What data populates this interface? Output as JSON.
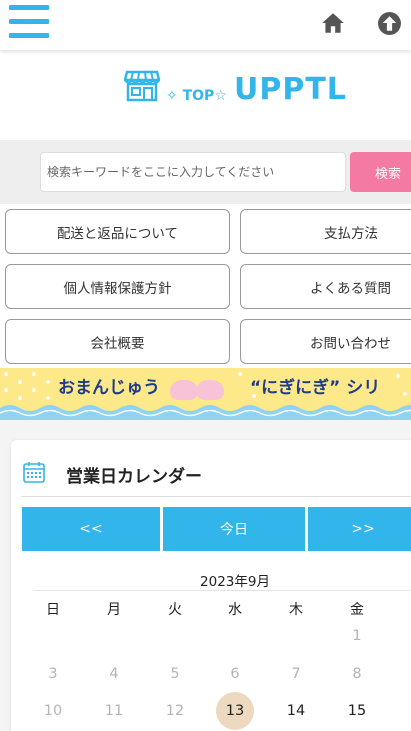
{
  "header": {
    "menu_icon": "hamburger-icon",
    "home_icon": "home-icon",
    "pagetop_icon": "arrow-up-circle-icon",
    "accent_color": "#32b5ea"
  },
  "logo": {
    "icon": "storefront-icon",
    "small_text": "✧ TOP☆",
    "main_text": "UPPTL"
  },
  "search": {
    "placeholder": "検索キーワードをここに入力してください",
    "button_label": "検索",
    "button_color": "#f57aa3"
  },
  "links": [
    {
      "label": "配送と返品について"
    },
    {
      "label": "支払方法"
    },
    {
      "label": "個人情報保護方針"
    },
    {
      "label": "よくある質問"
    },
    {
      "label": "会社概要"
    },
    {
      "label": "お問い合わせ"
    }
  ],
  "banner": {
    "text_left": "おまんじゅう",
    "text_right": "“にぎにぎ” シリ"
  },
  "calendar": {
    "icon": "calendar-icon",
    "title": "営業日カレンダー",
    "prev_label": "<<",
    "today_label": "今日",
    "next_label": ">>",
    "month": "2023年9月",
    "weekdays": [
      "日",
      "月",
      "火",
      "水",
      "木",
      "金"
    ],
    "week1": [
      "",
      "",
      "",
      "",
      "",
      "1"
    ],
    "week2": [
      "3",
      "4",
      "5",
      "6",
      "7",
      "8"
    ],
    "week3": [
      "10",
      "11",
      "12",
      "13",
      "14",
      "15"
    ],
    "today_value": "13",
    "today_color": "#ecd9bf"
  }
}
